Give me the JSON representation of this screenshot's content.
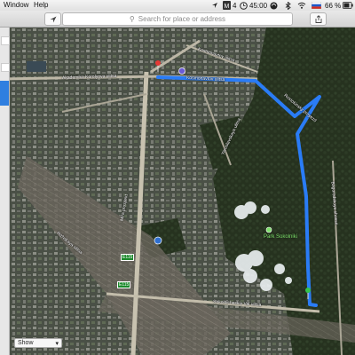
{
  "menubar": {
    "items": [
      "Window",
      "Help"
    ],
    "status": {
      "indicator": "4",
      "clock": "45:00",
      "battery_pct": "66 %",
      "flag_colors": [
        "#ffffff",
        "#1c57c8",
        "#d52b1e"
      ]
    }
  },
  "toolbar": {
    "location_icon": "arrow-icon",
    "search_placeholder": "Search for place or address"
  },
  "map": {
    "route_color": "#2a7cf6",
    "pin_colors": {
      "start": "#e53935",
      "end": "#35c24a"
    },
    "streets": [
      "Akademika Korolyova ulitsa",
      "Kosmonavtov ulitsa",
      "Kosmonavtov ulitsa",
      "Rostokinsky proyezd",
      "Yaroslavskaya ulitsa",
      "Bogorodskoye shosse",
      "Sokolnicheskiy Val ulitsa",
      "Mira prospekt",
      "Rizhskaya ulitsa"
    ],
    "park_label": "Park Sokolniki",
    "shields": [
      "E115",
      "E115"
    ]
  },
  "footer": {
    "show_label": "Show"
  }
}
